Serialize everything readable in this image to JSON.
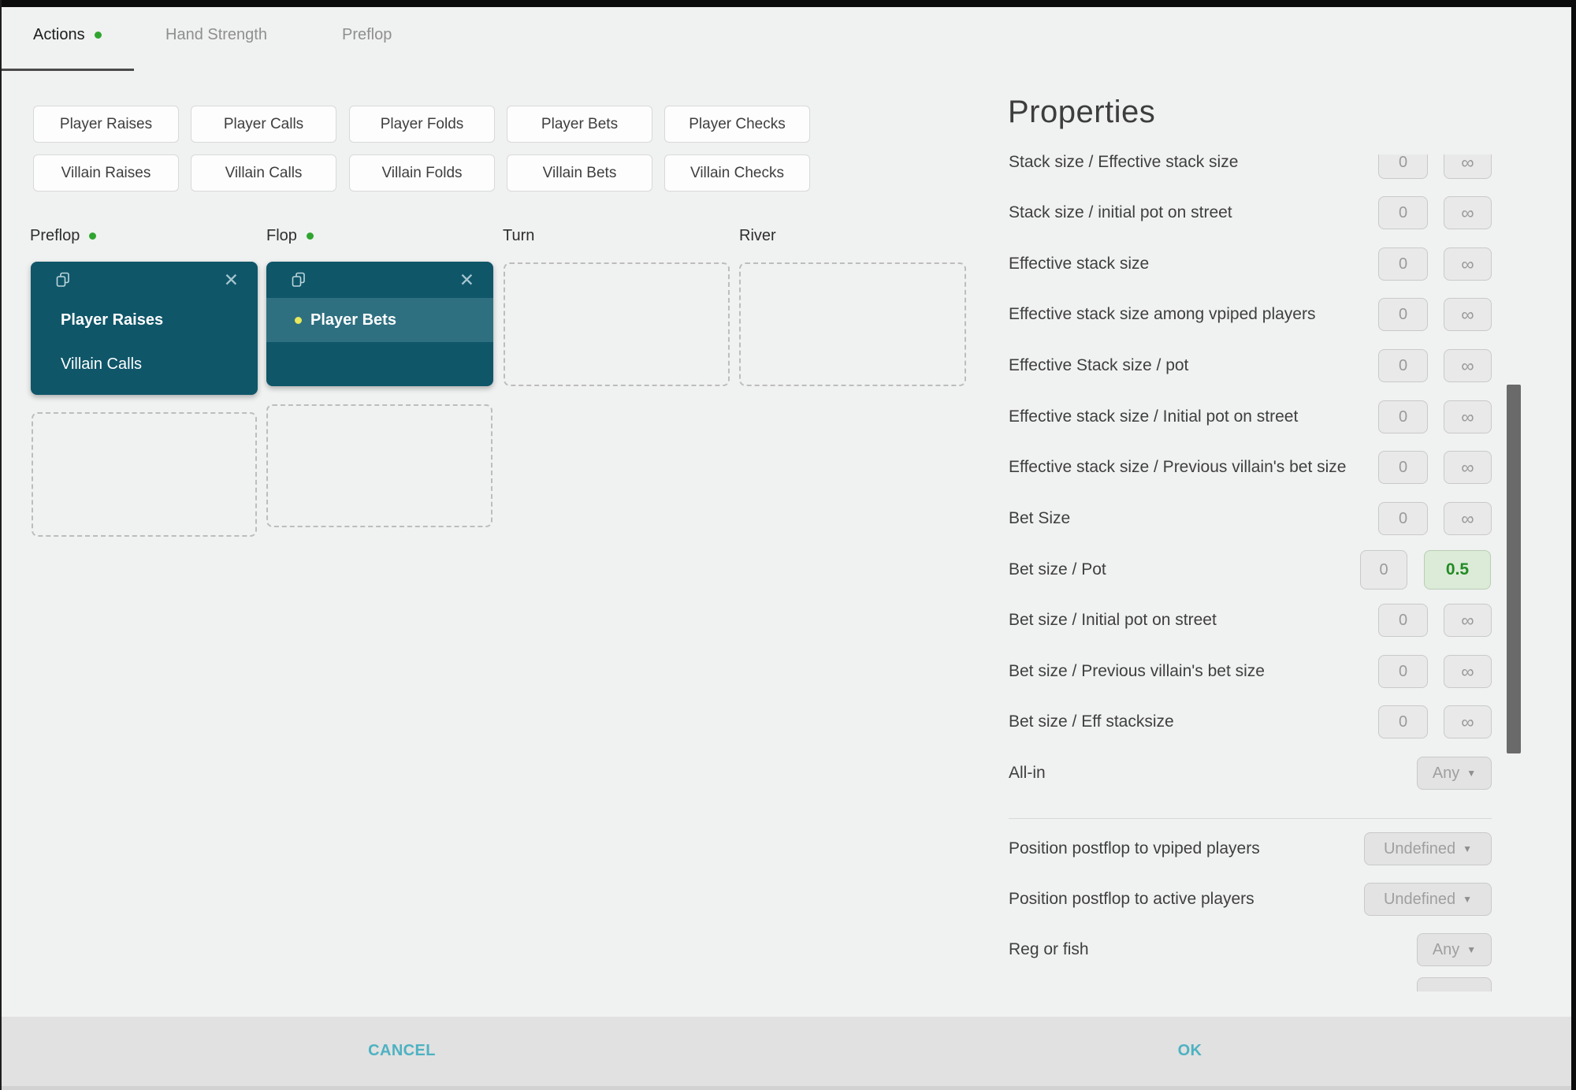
{
  "tabs": [
    {
      "label": "Actions",
      "active": true,
      "dot": true
    },
    {
      "label": "Hand Strength",
      "active": false,
      "dot": false
    },
    {
      "label": "Preflop",
      "active": false,
      "dot": false
    }
  ],
  "action_palette": {
    "player_row": [
      "Player Raises",
      "Player Calls",
      "Player Folds",
      "Player Bets",
      "Player Checks"
    ],
    "villain_row": [
      "Villain Raises",
      "Villain Calls",
      "Villain Folds",
      "Villain Bets",
      "Villain Checks"
    ]
  },
  "streets": {
    "preflop": {
      "label": "Preflop",
      "dot": true,
      "card": {
        "actions": [
          {
            "text": "Player Raises",
            "bold": true
          },
          {
            "text": "Villain Calls",
            "bold": false
          }
        ]
      }
    },
    "flop": {
      "label": "Flop",
      "dot": true,
      "card": {
        "actions": [
          {
            "text": "Player Bets",
            "bold": true,
            "bullet": true,
            "highlighted": true
          }
        ]
      }
    },
    "turn": {
      "label": "Turn",
      "dot": false
    },
    "river": {
      "label": "River",
      "dot": false
    }
  },
  "properties": {
    "title": "Properties",
    "range_rows": [
      {
        "label": "Stack size / Effective stack size",
        "min": "0",
        "max": "∞"
      },
      {
        "label": "Stack size / initial pot on street",
        "min": "0",
        "max": "∞"
      },
      {
        "label": "Effective stack size",
        "min": "0",
        "max": "∞"
      },
      {
        "label": "Effective stack size among vpiped players",
        "min": "0",
        "max": "∞"
      },
      {
        "label": "Effective Stack size / pot",
        "min": "0",
        "max": "∞"
      },
      {
        "label": "Effective stack size / Initial pot on street",
        "min": "0",
        "max": "∞"
      },
      {
        "label": "Effective stack size / Previous villain's bet size",
        "min": "0",
        "max": "∞"
      },
      {
        "label": "Bet Size",
        "min": "0",
        "max": "∞"
      },
      {
        "label": "Bet size / Pot",
        "min": "0",
        "max": "0.5",
        "selected": true
      },
      {
        "label": "Bet size / Initial pot on street",
        "min": "0",
        "max": "∞"
      },
      {
        "label": "Bet size / Previous villain's bet size",
        "min": "0",
        "max": "∞"
      },
      {
        "label": "Bet size / Eff stacksize",
        "min": "0",
        "max": "∞"
      }
    ],
    "dropdown_rows": [
      {
        "label": "All-in",
        "value": "Any"
      },
      {
        "label": "Position postflop to vpiped players",
        "value": "Undefined"
      },
      {
        "label": "Position postflop to active players",
        "value": "Undefined"
      },
      {
        "label": "Reg or fish",
        "value": "Any"
      }
    ]
  },
  "footer": {
    "cancel_label": "CANCEL",
    "ok_label": "OK"
  },
  "colors": {
    "card_teal": "#0f5669",
    "card_highlight_teal": "#2e7080",
    "selected_green_bg": "#dcead8",
    "selected_green_text": "#228b22",
    "footer_action_cyan": "#4db2c2",
    "status_dot_green": "#2fa52f",
    "active_bullet_yellow": "#e9e75a"
  }
}
